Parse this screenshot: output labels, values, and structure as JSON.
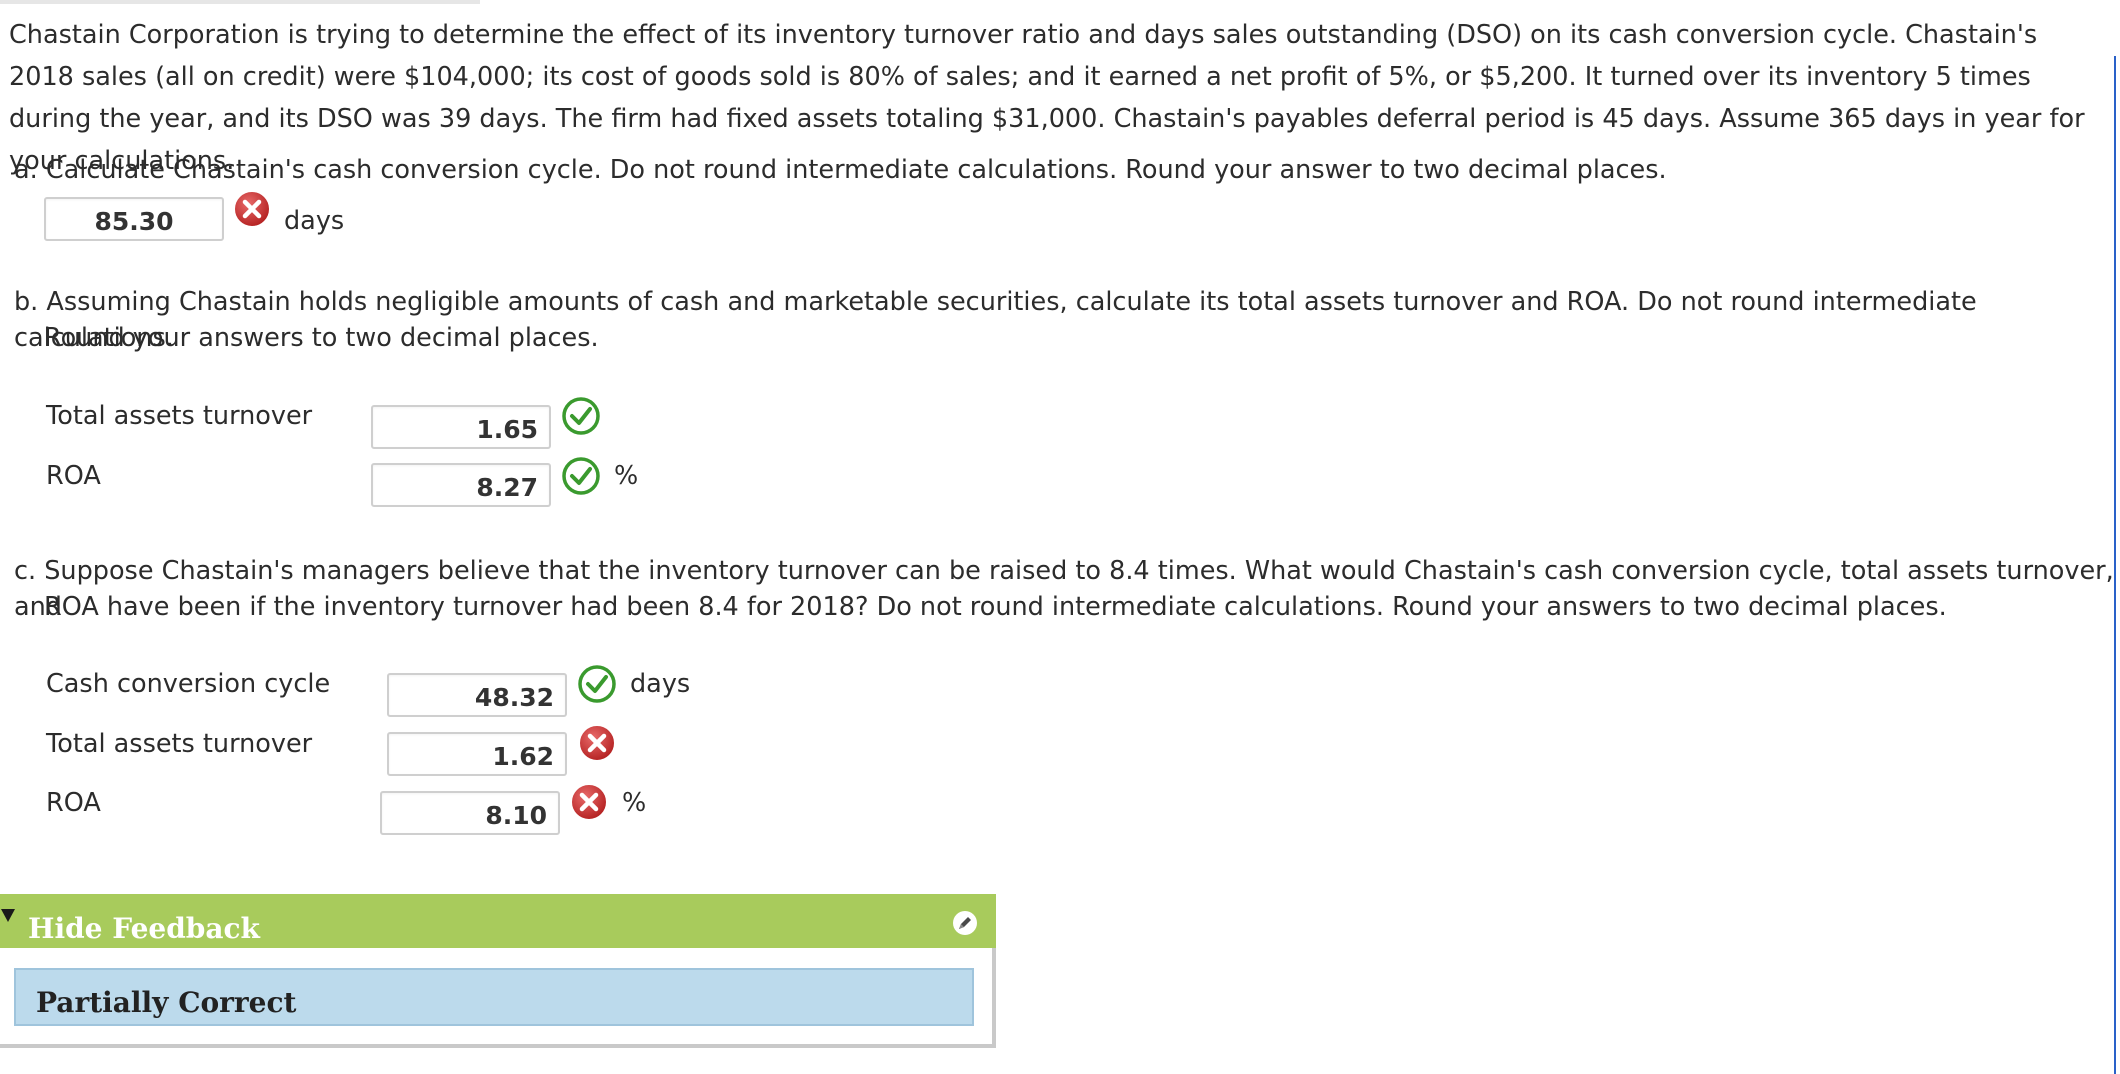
{
  "problem": {
    "text": "Chastain Corporation is trying to determine the effect of its inventory turnover ratio and days sales outstanding (DSO) on its cash conversion cycle. Chastain's 2018 sales (all on credit) were $104,000; its cost of goods sold is 80% of sales; and it earned a net profit of 5%, or $5,200. It turned over its inventory 5 times during the year, and its DSO was 39 days. The firm had fixed assets totaling $31,000. Chastain's payables deferral period is 45 days. Assume 365 days in year for your calculations."
  },
  "part_a": {
    "question": "a. Calculate Chastain's cash conversion cycle. Do not round intermediate calculations. Round your answer to two decimal places.",
    "answer": "85.30",
    "status": "incorrect",
    "unit": "days"
  },
  "part_b": {
    "question_line1": "b. Assuming Chastain holds negligible amounts of cash and marketable securities, calculate its total assets turnover and ROA. Do not round intermediate calculations.",
    "question_line2": "Round your answers to two decimal places.",
    "rows": [
      {
        "label": "Total assets turnover",
        "answer": "1.65",
        "status": "correct",
        "unit": ""
      },
      {
        "label": "ROA",
        "answer": "8.27",
        "status": "correct",
        "unit": "%"
      }
    ]
  },
  "part_c": {
    "question_line1": "c. Suppose Chastain's managers believe that the inventory turnover can be raised to 8.4 times. What would Chastain's cash conversion cycle, total assets turnover, and",
    "question_line2": "ROA have been if the inventory turnover had been 8.4 for 2018? Do not round intermediate calculations. Round your answers to two decimal places.",
    "rows": [
      {
        "label": "Cash conversion cycle",
        "answer": "48.32",
        "status": "correct",
        "unit": "days"
      },
      {
        "label": "Total assets turnover",
        "answer": "1.62",
        "status": "incorrect",
        "unit": ""
      },
      {
        "label": "ROA",
        "answer": "8.10",
        "status": "incorrect",
        "unit": "%"
      }
    ]
  },
  "feedback": {
    "toggle_label": "Hide Feedback",
    "status_text": "Partially Correct"
  },
  "colors": {
    "correct": "#3a9a2e",
    "incorrect": "#c43030",
    "feedback_bar": "#a8cb5c",
    "feedback_panel": "#bcdaec"
  },
  "icons": {
    "correct": "check-circle-icon",
    "incorrect": "x-circle-icon",
    "toggle": "triangle-down-icon",
    "edit": "pencil-icon"
  }
}
